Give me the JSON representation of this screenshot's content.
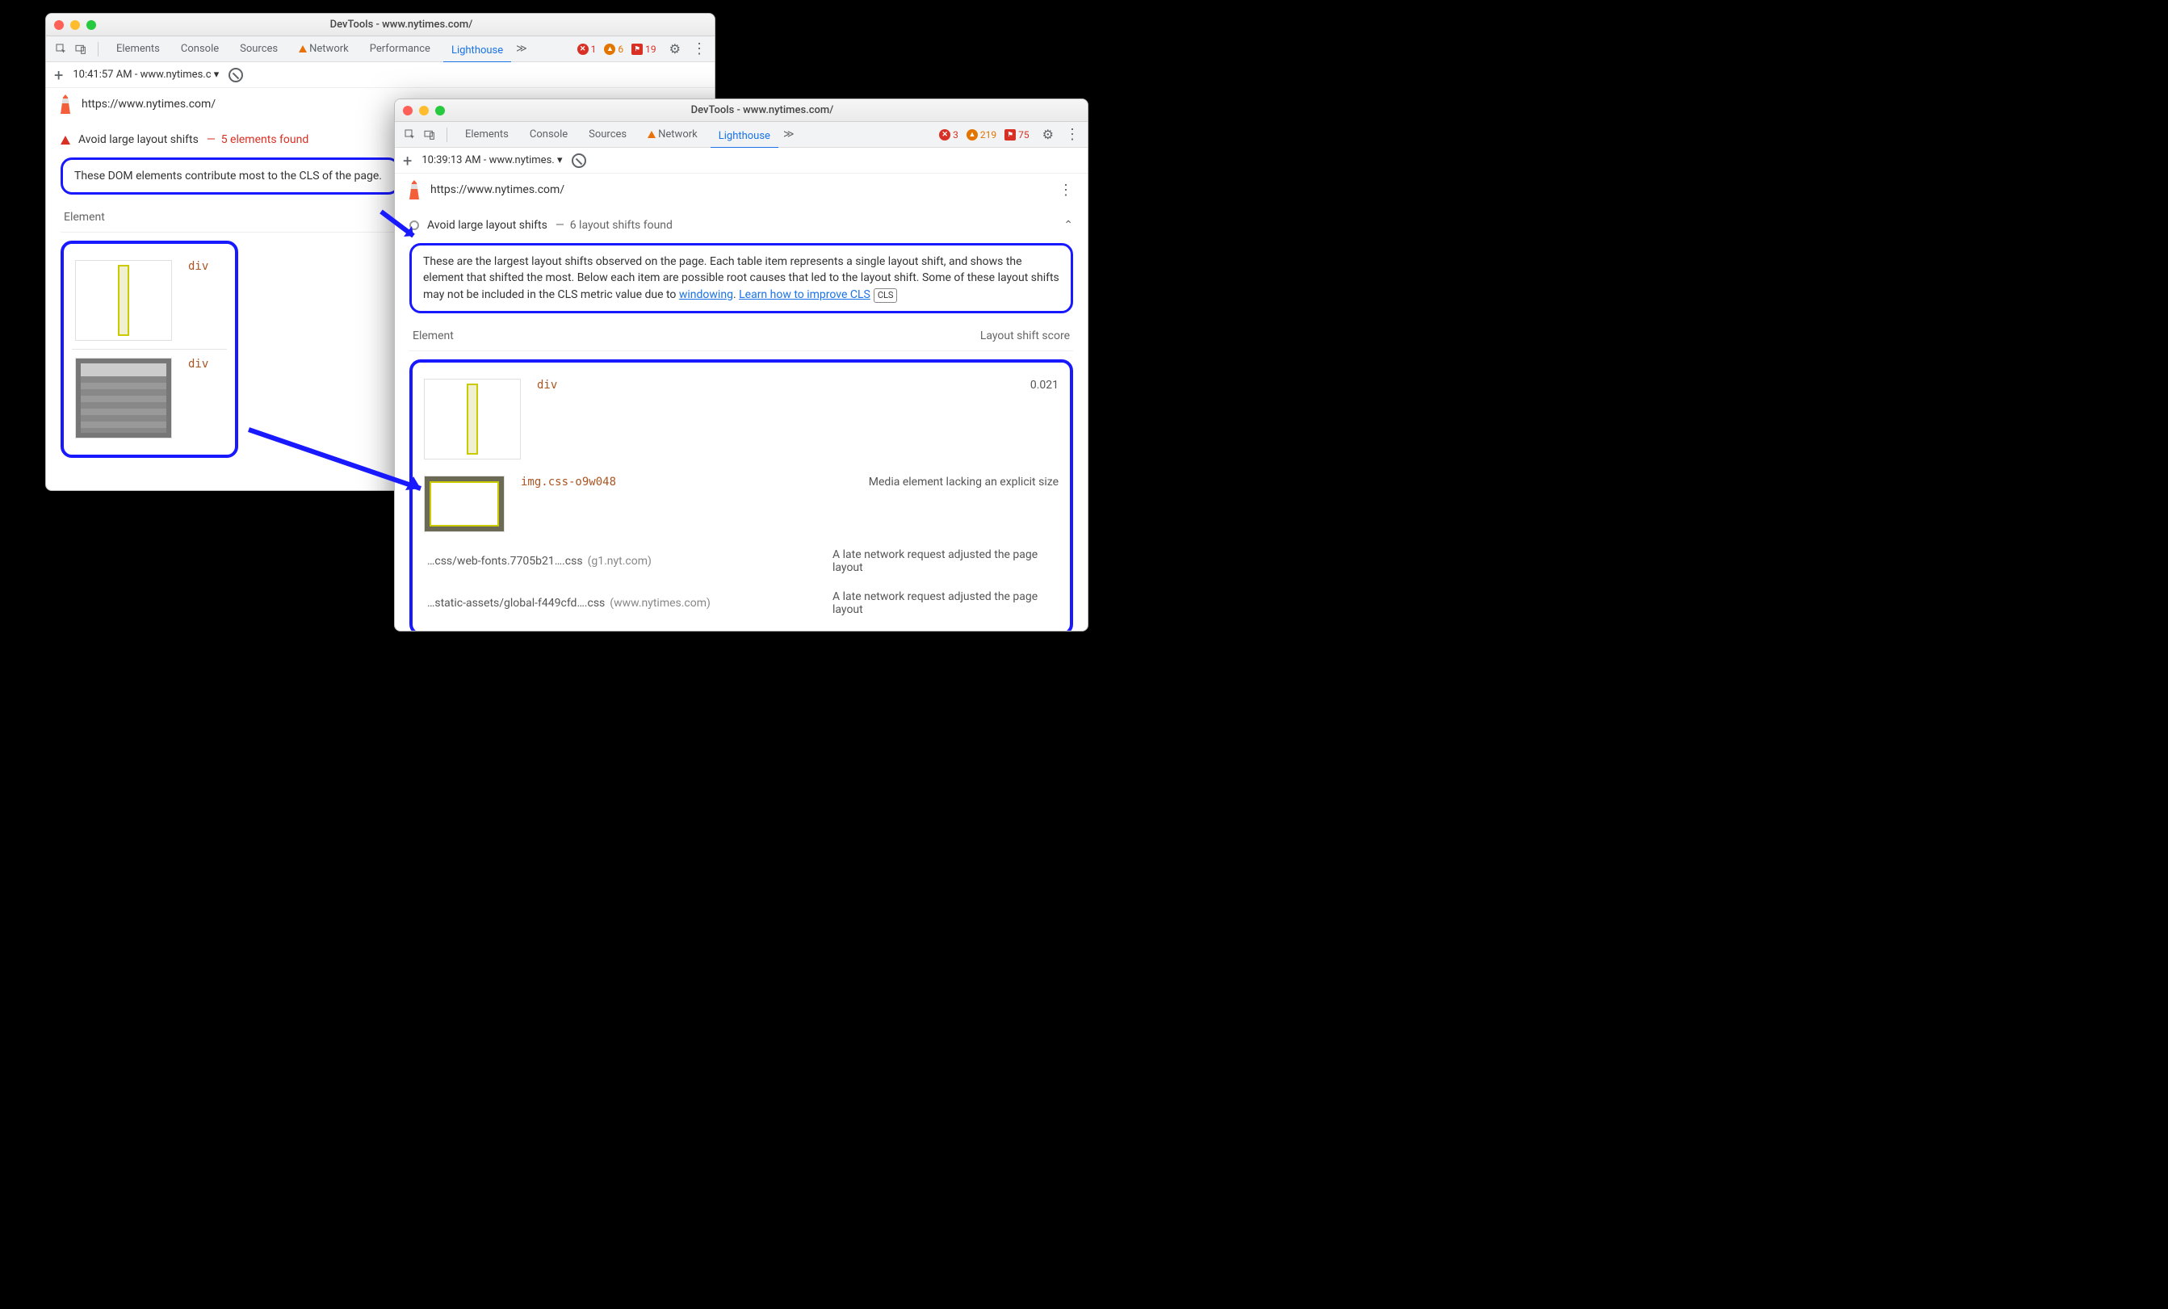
{
  "tabs": {
    "elements": "Elements",
    "console": "Console",
    "sources": "Sources",
    "network": "Network",
    "performance": "Performance",
    "lighthouse": "Lighthouse"
  },
  "icons": {
    "gear": "⚙",
    "kebab": "⋮"
  },
  "win1": {
    "title": "DevTools - www.nytimes.com/",
    "errors": "1",
    "warnings": "6",
    "violations": "19",
    "run_label": "10:41:57 AM - www.nytimes.c",
    "url": "https://www.nytimes.com/",
    "audit_title": "Avoid large layout shifts",
    "audit_dash": "—",
    "audit_count": "5 elements found",
    "desc": "These DOM elements contribute most to the CLS of the page.",
    "col_element": "Element",
    "rows": [
      {
        "tag": "div"
      },
      {
        "tag": "div"
      }
    ]
  },
  "win2": {
    "title": "DevTools - www.nytimes.com/",
    "errors": "3",
    "warnings": "219",
    "violations": "75",
    "run_label": "10:39:13 AM - www.nytimes.",
    "url": "https://www.nytimes.com/",
    "audit_title": "Avoid large layout shifts",
    "audit_dash": "—",
    "audit_count": "6 layout shifts found",
    "desc_p1": "These are the largest layout shifts observed on the page. Each table item represents a single layout shift, and shows the element that shifted the most. Below each item are possible root causes that led to the layout shift. Some of these layout shifts may not be included in the CLS metric value due to ",
    "desc_link1": "windowing",
    "desc_sep": ". ",
    "desc_link2": "Learn how to improve CLS",
    "cls_chip": "CLS",
    "col_element": "Element",
    "col_score": "Layout shift score",
    "row1": {
      "tag": "div",
      "score": "0.021"
    },
    "row2": {
      "tag": "img.css-o9w048",
      "reason": "Media element lacking an explicit size"
    },
    "file1": {
      "name": "…css/web-fonts.7705b21….css",
      "domain": "(g1.nyt.com)",
      "reason": "A late network request adjusted the page layout"
    },
    "file2": {
      "name": "…static-assets/global-f449cfd….css",
      "domain": "(www.nytimes.com)",
      "reason": "A late network request adjusted the page layout"
    }
  }
}
